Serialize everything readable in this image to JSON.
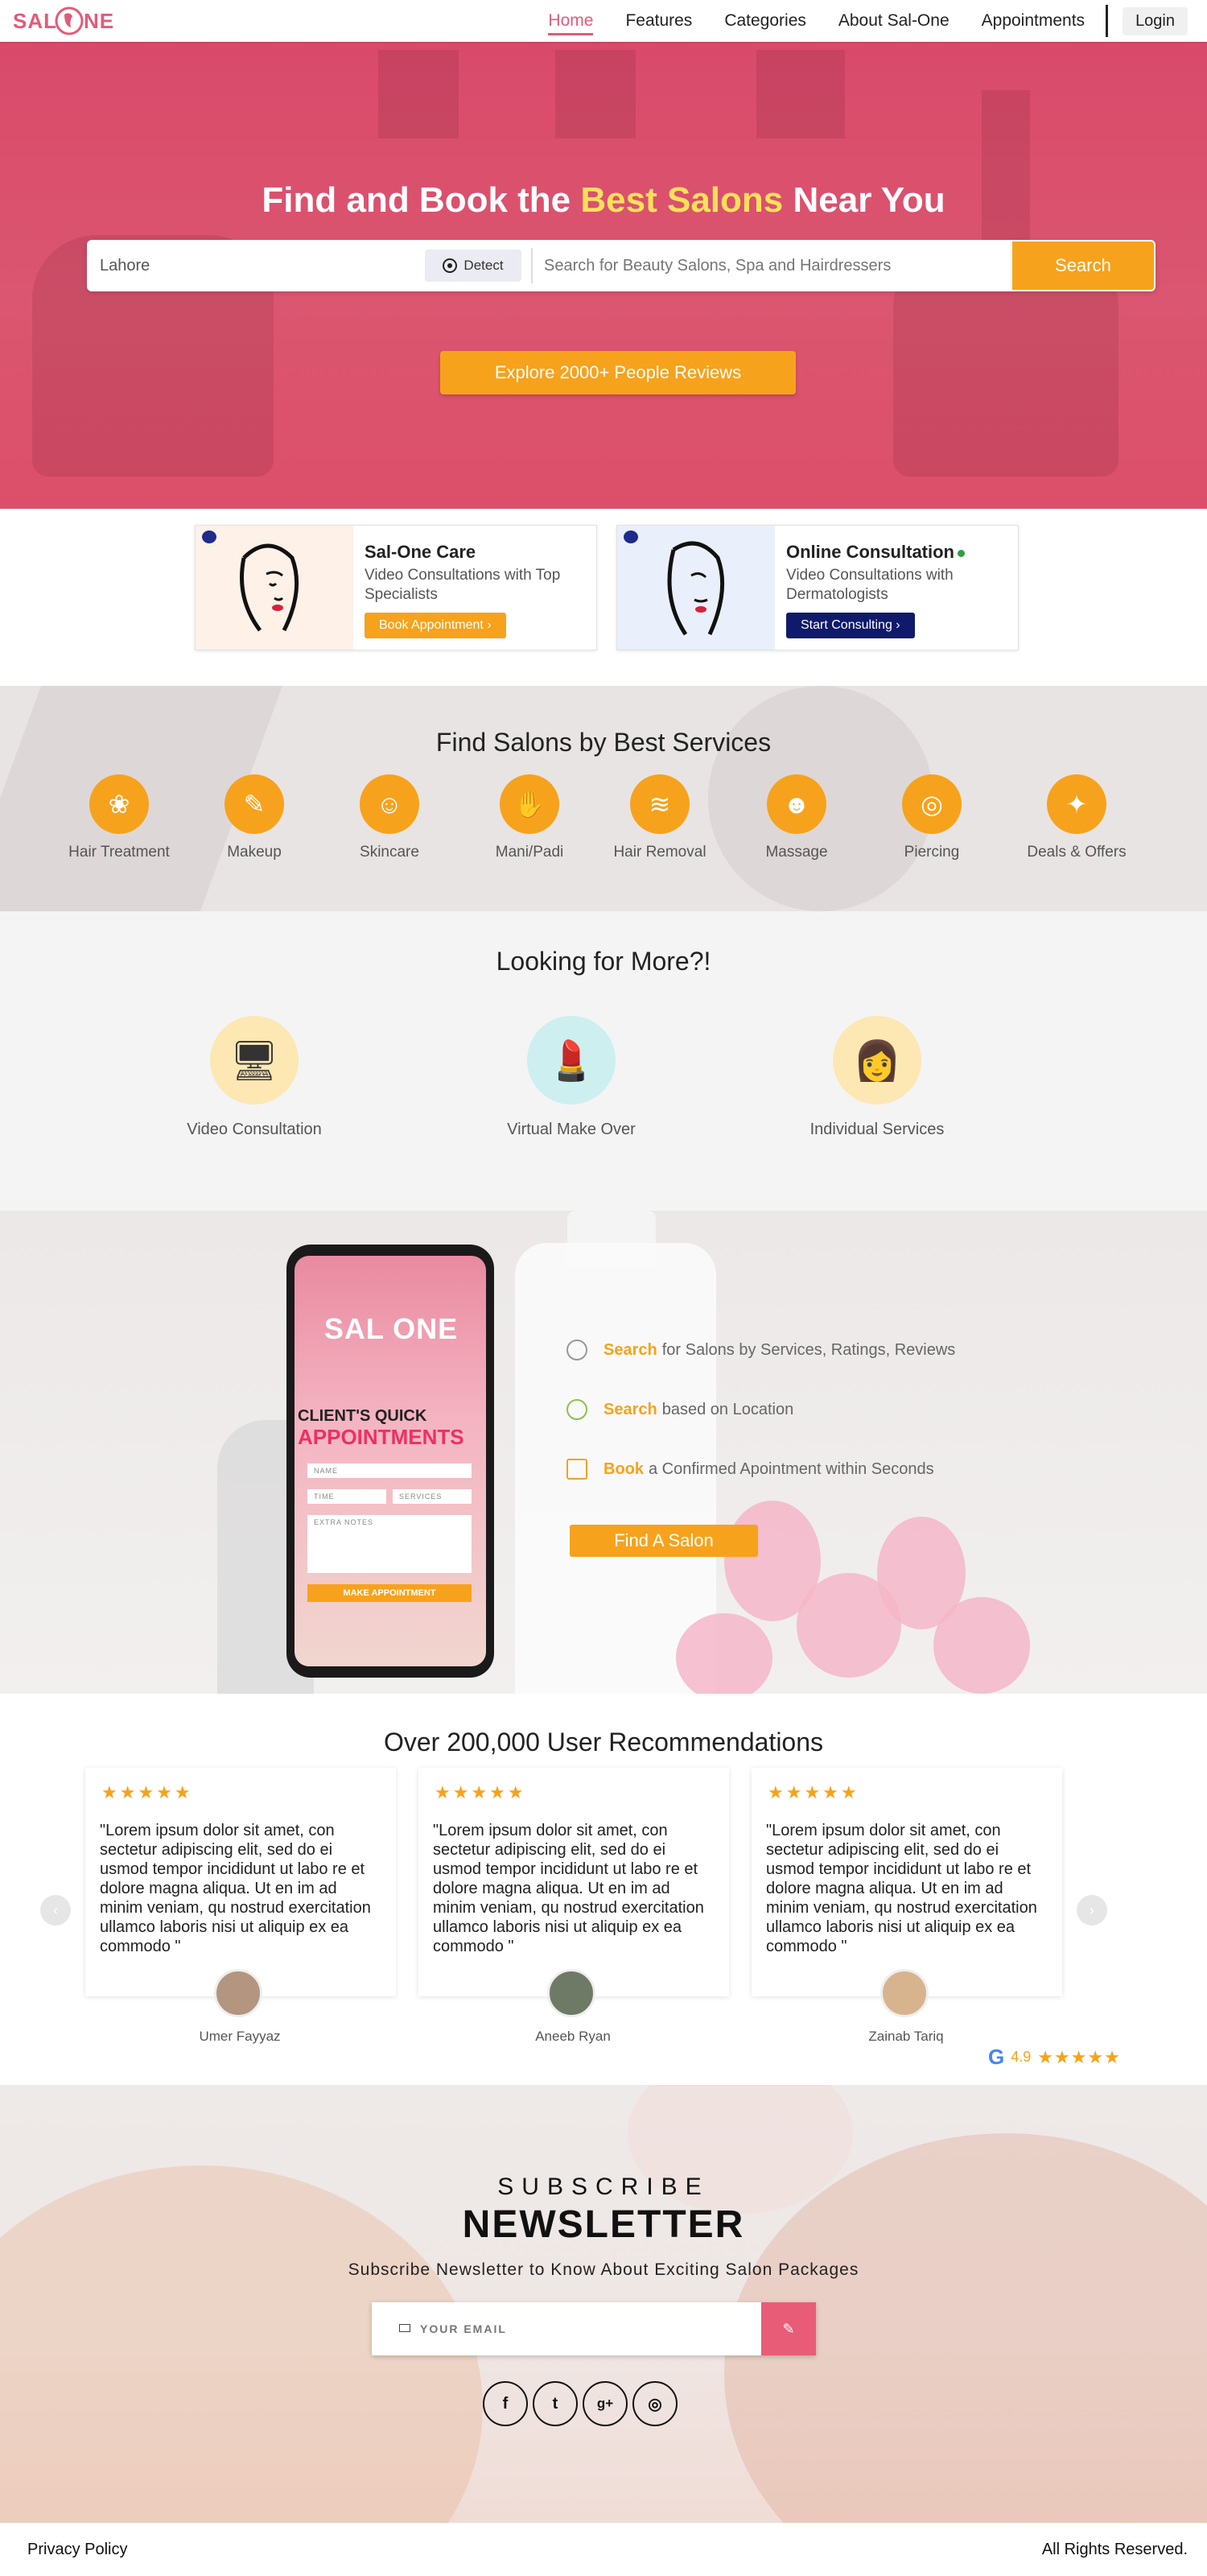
{
  "brand": {
    "logo_text": "SALONE"
  },
  "nav": {
    "items": [
      "Home",
      "Features",
      "Categories",
      "About Sal-One",
      "Appointments"
    ],
    "login": "Login"
  },
  "hero": {
    "title_before": "Find and Book the ",
    "title_highlight": "Best Salons",
    "title_after": " Near You",
    "location_value": "Lahore",
    "detect_label": "Detect",
    "search_placeholder": "Search for Beauty Salons, Spa and Hairdressers",
    "search_label": "Search",
    "reviews_cta": "Explore 2000+ People Reviews"
  },
  "care_cards": [
    {
      "title": "Sal-One Care",
      "subtitle": "Video Consultations with Top Specialists",
      "cta": "Book Appointment ›",
      "cta_color": "#f7a21c",
      "art_bg": "#fdf1e8"
    },
    {
      "title": "Online Consultation",
      "subtitle": "Video Consultations with Dermatologists",
      "cta": "Start Consulting ›",
      "cta_color": "#101a6b",
      "art_bg": "#e9f0fb"
    }
  ],
  "services": {
    "title": "Find Salons by Best Services",
    "items": [
      {
        "label": "Hair Treatment",
        "icon": "hair-icon",
        "glyph": "❀"
      },
      {
        "label": "Makeup",
        "icon": "makeup-icon",
        "glyph": "✎"
      },
      {
        "label": "Skincare",
        "icon": "face-mask-icon",
        "glyph": "☺"
      },
      {
        "label": "Mani/Padi",
        "icon": "nail-polish-icon",
        "glyph": "✋"
      },
      {
        "label": "Hair Removal",
        "icon": "wax-icon",
        "glyph": "≋"
      },
      {
        "label": "Massage",
        "icon": "massage-icon",
        "glyph": "☻"
      },
      {
        "label": "Piercing",
        "icon": "earring-icon",
        "glyph": "◎"
      },
      {
        "label": "Deals & Offers",
        "icon": "tag-icon",
        "glyph": "✦"
      }
    ]
  },
  "more": {
    "title": "Looking for More?!",
    "items": [
      {
        "label": "Video Consultation",
        "icon": "monitor-icon",
        "glyph": "🖥",
        "bg": "#fde7b3"
      },
      {
        "label": "Virtual Make Over",
        "icon": "lipstick-icon",
        "glyph": "💄",
        "bg": "#cdeff0"
      },
      {
        "label": "Individual Services",
        "icon": "woman-avatar-icon",
        "glyph": "👩",
        "bg": "#fde7b3"
      }
    ]
  },
  "app_promo": {
    "phone_logo": "SAL ONE",
    "phone_heading_1": "CLIENT'S QUICK",
    "phone_heading_2": "APPOINTMENTS",
    "phone_fields": [
      "NAME",
      "TIME",
      "SERVICES",
      "EXTRA NOTES"
    ],
    "phone_cta": "MAKE APPOINTMENT",
    "features": [
      {
        "keyword": "Search",
        "text": "for Salons by Services, Ratings, Reviews",
        "icon": "search-icon"
      },
      {
        "keyword": "Search",
        "text": "based on Location",
        "icon": "check-circle-icon"
      },
      {
        "keyword": "Book",
        "text": "a Confirmed Apointment within Seconds",
        "icon": "calendar-plus-icon"
      }
    ],
    "cta": "Find A Salon"
  },
  "recommendations": {
    "title": "Over 200,000 User Recommendations",
    "stars": "★★★★★",
    "reviews": [
      {
        "text": "\"Lorem ipsum dolor sit amet, con sectetur adipiscing elit, sed do ei usmod tempor incididunt ut labo re et dolore magna aliqua. Ut en im ad minim veniam, qu nostrud exercitation ullamco laboris nisi ut aliquip ex ea commodo \"",
        "name": "Umer Fayyaz",
        "avatar_bg": "#b39580"
      },
      {
        "text": "\"Lorem ipsum dolor sit amet, con sectetur adipiscing elit, sed do ei usmod tempor incididunt ut labo re et dolore magna aliqua. Ut en im ad minim veniam, qu nostrud exercitation ullamco laboris nisi ut aliquip ex ea commodo \"",
        "name": "Aneeb Ryan",
        "avatar_bg": "#6f7a66"
      },
      {
        "text": "\"Lorem ipsum dolor sit amet, con sectetur adipiscing elit, sed do ei usmod tempor incididunt ut labo re et dolore magna aliqua. Ut en im ad minim veniam, qu nostrud exercitation ullamco laboris nisi ut aliquip ex ea commodo \"",
        "name": "Zainab Tariq",
        "avatar_bg": "#d8b48e"
      }
    ],
    "prev": "‹",
    "next": "›",
    "google_rating": "4.9",
    "google_glyph": "G",
    "google_stars": "★★★★★"
  },
  "newsletter": {
    "kicker": "SUBSCRIBE",
    "title": "NEWSLETTER",
    "description": "Subscribe Newsletter to Know About Exciting Salon Packages",
    "email_placeholder": "YOUR EMAIL",
    "submit_glyph": "✎",
    "socials": [
      {
        "glyph": "f",
        "icon": "facebook-icon"
      },
      {
        "glyph": "t",
        "icon": "twitter-icon"
      },
      {
        "glyph": "g+",
        "icon": "google-plus-icon"
      },
      {
        "glyph": "◎",
        "icon": "instagram-icon"
      }
    ]
  },
  "footer": {
    "left": "Privacy Policy",
    "right": "All Rights Reserved."
  },
  "colors": {
    "brand_pink": "#e35a79",
    "accent_orange": "#f7a21c",
    "navy": "#101a6b"
  }
}
